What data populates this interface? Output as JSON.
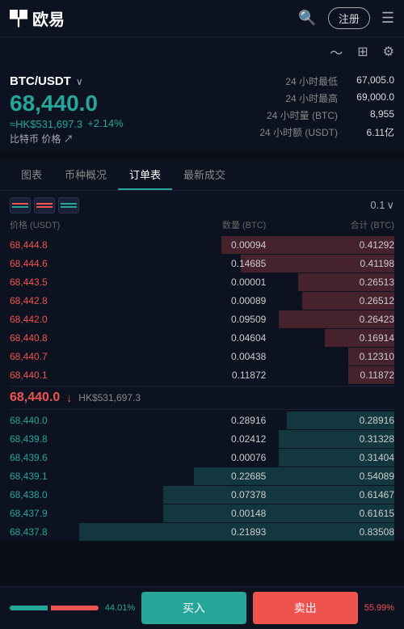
{
  "header": {
    "logo_text": "欧易",
    "register_label": "注册",
    "icons": [
      "search",
      "register",
      "menu"
    ]
  },
  "subheader": {
    "icons": [
      "chart-line",
      "grid",
      "settings"
    ]
  },
  "market": {
    "pair": "BTC/USDT",
    "main_price": "68,440.0",
    "hk_price": "≈HK$531,697.3",
    "change_pct": "+2.14%",
    "btc_label": "比特币 价格",
    "stats": [
      {
        "label": "24 小时最低",
        "value": "67,005.0"
      },
      {
        "label": "24 小时最高",
        "value": "69,000.0"
      },
      {
        "label": "24 小时量 (BTC)",
        "value": "8,955"
      },
      {
        "label": "24 小时额 (USDT)",
        "value": "6.11亿"
      }
    ]
  },
  "tabs": [
    "图表",
    "币种概况",
    "订单表",
    "最新成交"
  ],
  "active_tab_index": 2,
  "orderbook": {
    "decimal_label": "0.1",
    "col_headers": {
      "price": "价格 (USDT)",
      "qty": "数量 (BTC)",
      "total": "合计 (BTC)"
    },
    "asks": [
      {
        "price": "68,444.8",
        "qty": "0.00094",
        "total": "0.41292",
        "bar_pct": 45
      },
      {
        "price": "68,444.6",
        "qty": "0.14685",
        "total": "0.41198",
        "bar_pct": 40
      },
      {
        "price": "68,443.5",
        "qty": "0.00001",
        "total": "0.26513",
        "bar_pct": 25
      },
      {
        "price": "68,442.8",
        "qty": "0.00089",
        "total": "0.26512",
        "bar_pct": 24
      },
      {
        "price": "68,442.0",
        "qty": "0.09509",
        "total": "0.26423",
        "bar_pct": 30
      },
      {
        "price": "68,440.8",
        "qty": "0.04604",
        "total": "0.16914",
        "bar_pct": 18
      },
      {
        "price": "68,440.7",
        "qty": "0.00438",
        "total": "0.12310",
        "bar_pct": 12
      },
      {
        "price": "68,440.1",
        "qty": "0.11872",
        "total": "0.11872",
        "bar_pct": 12
      }
    ],
    "mid_price": "68,440.0",
    "mid_hk": "HK$531,697.3",
    "mid_direction": "down",
    "bids": [
      {
        "price": "68,440.0",
        "qty": "0.28916",
        "total": "0.28916",
        "bar_pct": 28
      },
      {
        "price": "68,439.8",
        "qty": "0.02412",
        "total": "0.31328",
        "bar_pct": 30
      },
      {
        "price": "68,439.6",
        "qty": "0.00076",
        "total": "0.31404",
        "bar_pct": 30
      },
      {
        "price": "68,439.1",
        "qty": "0.22685",
        "total": "0.54089",
        "bar_pct": 52
      },
      {
        "price": "68,438.0",
        "qty": "0.07378",
        "total": "0.61467",
        "bar_pct": 60
      },
      {
        "price": "68,437.9",
        "qty": "0.00148",
        "total": "0.61615",
        "bar_pct": 60
      },
      {
        "price": "68,437.8",
        "qty": "0.21893",
        "total": "0.83508",
        "bar_pct": 82
      }
    ]
  },
  "bottom": {
    "buy_label": "买入",
    "sell_label": "卖出",
    "buy_pct": "44.01%",
    "sell_pct": "55.99%"
  }
}
